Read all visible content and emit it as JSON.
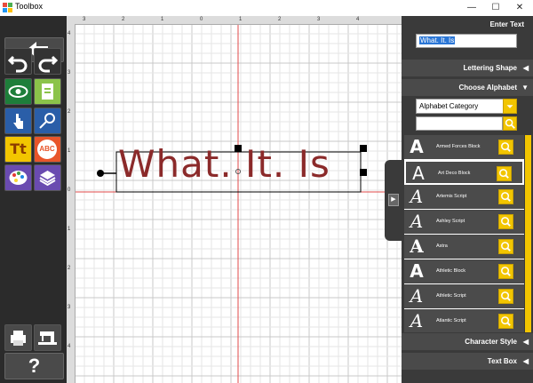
{
  "window": {
    "title": "Toolbox",
    "minimize_glyph": "—",
    "maximize_glyph": "☐",
    "close_glyph": "✕"
  },
  "canvas": {
    "text": "What. It. Is",
    "text_color": "#8b2a2a",
    "ruler_top": [
      "3",
      "2",
      "1",
      "0",
      "1",
      "2",
      "3",
      "4"
    ],
    "ruler_left": [
      "4",
      "3",
      "2",
      "1",
      "0",
      "1",
      "2",
      "3",
      "4"
    ]
  },
  "panel": {
    "enter_text": "Enter Text",
    "text_value": "What. It. Is",
    "lettering_shape": "Lettering Shape",
    "choose_alphabet": "Choose Alphabet",
    "category_placeholder": "Alphabet Category",
    "character_style": "Character Style",
    "text_box": "Text Box",
    "fonts": [
      {
        "name": "Armed Forces Block",
        "glyph": "A"
      },
      {
        "name": "Art Deco Block",
        "glyph": "A"
      },
      {
        "name": "Artemis Script",
        "glyph": "A"
      },
      {
        "name": "Ashley Script",
        "glyph": "A"
      },
      {
        "name": "Astra",
        "glyph": "A"
      },
      {
        "name": "Athletic Block",
        "glyph": "A"
      },
      {
        "name": "Athletic Script",
        "glyph": "A"
      },
      {
        "name": "Atlantic Script",
        "glyph": "A"
      }
    ],
    "selected_font": "Art Deco Block"
  },
  "colors": {
    "accent": "#f2c500",
    "panel_bg": "#3a3a3a",
    "toolbar_bg": "#2b2b2b",
    "guide": "#e24a4a"
  },
  "toolbar": {
    "help_glyph": "?",
    "text_glyph": "Tt",
    "monogram_glyph": "ABC"
  }
}
